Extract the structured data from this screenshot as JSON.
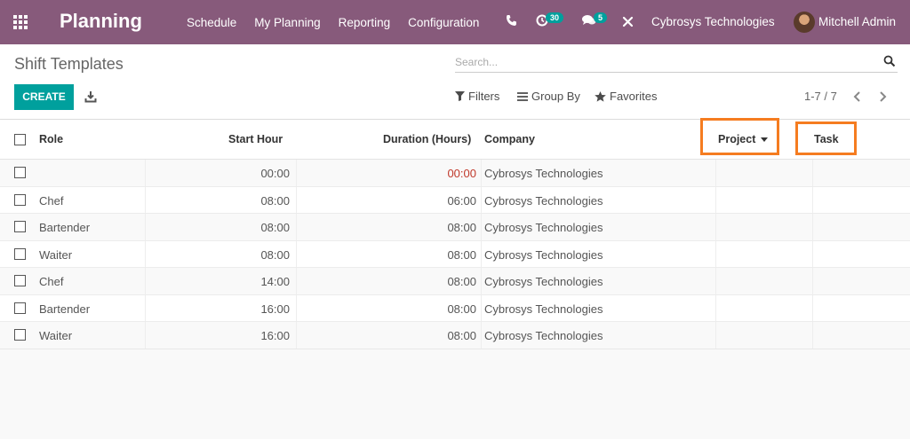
{
  "navbar": {
    "brand": "Planning",
    "menu": [
      "Schedule",
      "My Planning",
      "Reporting",
      "Configuration"
    ],
    "activity_count": "30",
    "message_count": "5",
    "company": "Cybrosys Technologies",
    "user": "Mitchell Admin",
    "color": "#875a7b"
  },
  "control": {
    "title": "Shift Templates",
    "search_placeholder": "Search...",
    "create_label": "CREATE",
    "filters_label": "Filters",
    "groupby_label": "Group By",
    "favorites_label": "Favorites",
    "pager": "1-7 / 7"
  },
  "table": {
    "headers": {
      "role": "Role",
      "start_hour": "Start Hour",
      "duration": "Duration (Hours)",
      "company": "Company",
      "project": "Project",
      "task": "Task"
    },
    "rows": [
      {
        "role": "",
        "start": "00:00",
        "duration": "00:00",
        "company": "Cybrosys Technologies"
      },
      {
        "role": "Chef",
        "start": "08:00",
        "duration": "06:00",
        "company": "Cybrosys Technologies"
      },
      {
        "role": "Bartender",
        "start": "08:00",
        "duration": "08:00",
        "company": "Cybrosys Technologies"
      },
      {
        "role": "Waiter",
        "start": "08:00",
        "duration": "08:00",
        "company": "Cybrosys Technologies"
      },
      {
        "role": "Chef",
        "start": "14:00",
        "duration": "08:00",
        "company": "Cybrosys Technologies"
      },
      {
        "role": "Bartender",
        "start": "16:00",
        "duration": "08:00",
        "company": "Cybrosys Technologies"
      },
      {
        "role": "Waiter",
        "start": "16:00",
        "duration": "08:00",
        "company": "Cybrosys Technologies"
      }
    ]
  },
  "colors": {
    "accent": "#00a09d",
    "highlight": "#f57c20"
  }
}
